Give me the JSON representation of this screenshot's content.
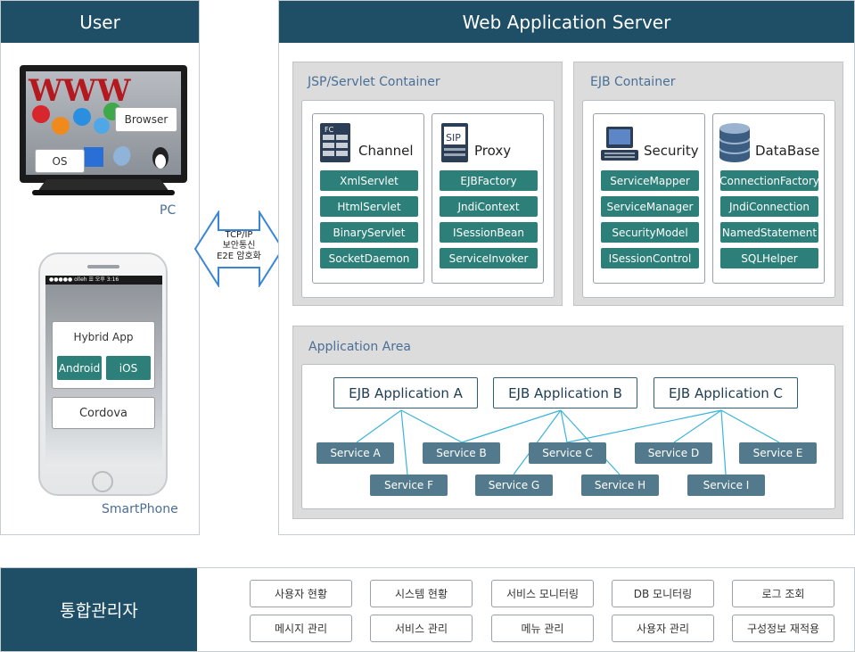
{
  "user": {
    "title": "User",
    "pc_label": "PC",
    "browser_label": "Browser",
    "os_label": "OS",
    "smartphone_label": "SmartPhone",
    "phone_status": "●●●●● olleh  ☰   오후 3:16",
    "hybrid_app": "Hybrid App",
    "android": "Android",
    "ios": "iOS",
    "cordova": "Cordova"
  },
  "arrow": {
    "line1": "TCP/IP",
    "line2": "보안통신",
    "line3": "E2E 암호화"
  },
  "was": {
    "title": "Web Application Server",
    "jsp_container": "JSP/Servlet Container",
    "ejb_container": "EJB Container",
    "channel": {
      "title": "Channel",
      "icon_text": "FC",
      "items": [
        "XmlServlet",
        "HtmlServlet",
        "BinaryServlet",
        "SocketDaemon"
      ]
    },
    "proxy": {
      "title": "Proxy",
      "icon_text": "SIP",
      "items": [
        "EJBFactory",
        "JndiContext",
        "ISessionBean",
        "ServiceInvoker"
      ]
    },
    "security": {
      "title": "Security",
      "items": [
        "ServiceMapper",
        "ServiceManager",
        "SecurityModel",
        "ISessionControl"
      ]
    },
    "database": {
      "title": "DataBase",
      "items": [
        "ConnectionFactory",
        "JndiConnection",
        "NamedStatement",
        "SQLHelper"
      ]
    },
    "app_area": {
      "title": "Application Area",
      "apps": [
        "EJB Application A",
        "EJB Application B",
        "EJB Application C"
      ],
      "services": [
        "Service A",
        "Service B",
        "Service C",
        "Service D",
        "Service E",
        "Service F",
        "Service G",
        "Service H",
        "Service I"
      ]
    }
  },
  "admin": {
    "title": "통합관리자",
    "buttons": [
      "사용자 현황",
      "시스템 현황",
      "서비스 모니터링",
      "DB 모니터링",
      "로그 조회",
      "메시지 관리",
      "서비스 관리",
      "메뉴 관리",
      "사용자 관리",
      "구성정보 재적용"
    ]
  },
  "colors": {
    "header": "#1e4f66",
    "teal_button": "#2c8079",
    "service": "#537a8c",
    "line": "#3bb4d8",
    "title_blue": "#4a6f96"
  }
}
